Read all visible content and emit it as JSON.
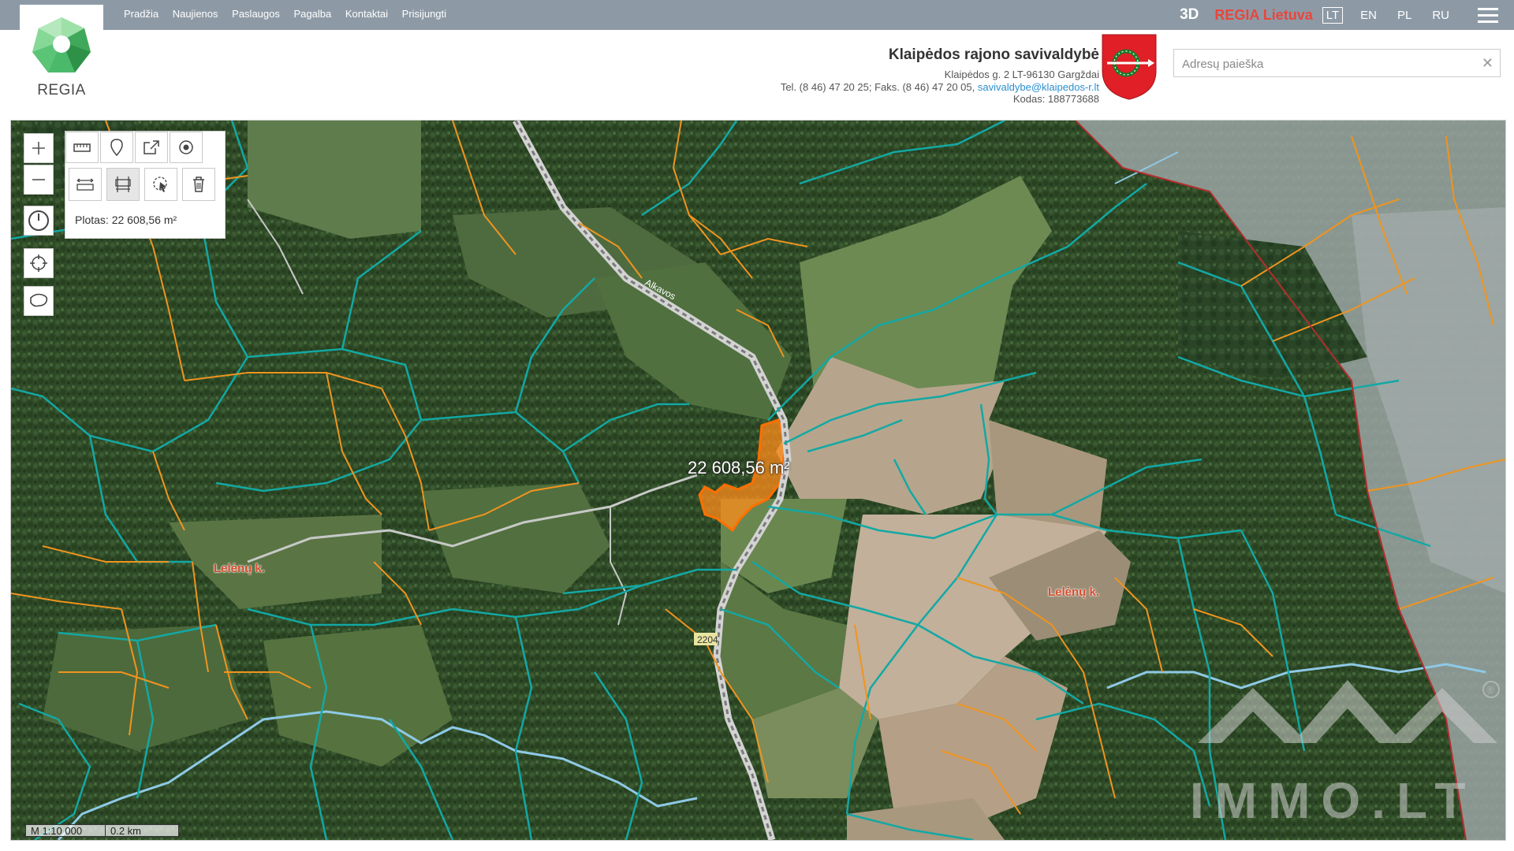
{
  "nav": {
    "items": [
      "Pradžia",
      "Naujienos",
      "Paslaugos",
      "Pagalba",
      "Kontaktai",
      "Prisijungti"
    ],
    "btn_3d": "3D",
    "regia_lietuva": "REGIA Lietuva",
    "languages": [
      {
        "code": "LT",
        "active": true
      },
      {
        "code": "EN",
        "active": false
      },
      {
        "code": "PL",
        "active": false
      },
      {
        "code": "RU",
        "active": false
      }
    ],
    "menu_icon": "hamburger-icon"
  },
  "logo": {
    "text": "REGIA",
    "color": "#4bb96a"
  },
  "header": {
    "title": "Klaipėdos rajono savivaldybė",
    "address": "Klaipėdos g. 2 LT-96130 Gargždai",
    "contacts_prefix": "Tel. (8 46) 47 20 25; Faks. (8 46) 47 20 05,",
    "email": "savivaldybe@klaipedos-r.lt",
    "code": "Kodas: 188773688"
  },
  "search": {
    "placeholder": "Adresų paieška",
    "value": "",
    "clear_icon": "close-icon"
  },
  "map": {
    "tools": {
      "zoom_in": "plus-icon",
      "zoom_out": "minus-icon",
      "history": "clock-icon",
      "locate": "crosshair-icon",
      "draw_area": "lasso-icon",
      "measure_tabs": [
        "ruler-icon",
        "pin-icon",
        "export-icon",
        "target-icon"
      ],
      "measure_actions": [
        "measure-distance-icon",
        "measure-area-icon",
        "cursor-select-icon",
        "trash-icon"
      ]
    },
    "area_result": "Plotas: 22 608,56 m²",
    "measured_area_label": "22 608,56 m²",
    "place_labels": [
      "Lelėnų k.",
      "Lelėnų k."
    ],
    "road_labels": [
      "Alkavos",
      "2204"
    ],
    "scale_ratio": "M 1:10 000",
    "scale_distance": "0.2 km",
    "watermark": "IMMO.LT",
    "parcel_colors": {
      "teal": "#13a8a4",
      "orange": "#f0941e",
      "boundary": "#b22e2e",
      "highlight": "#ff8c1a"
    }
  }
}
